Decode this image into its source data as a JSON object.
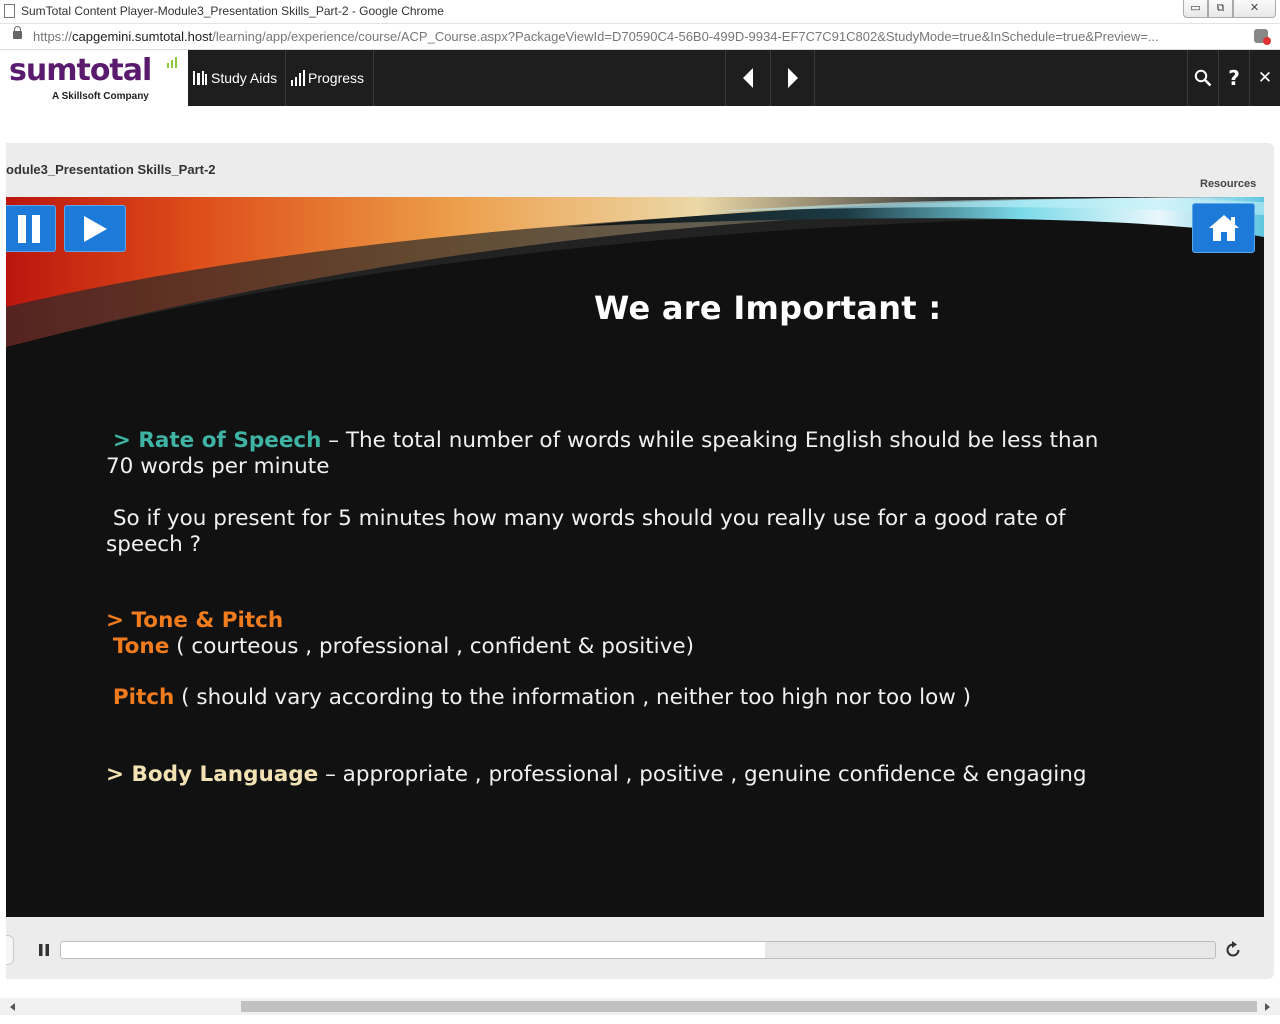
{
  "window": {
    "title": "SumTotal Content Player-Module3_Presentation Skills_Part-2 - Google Chrome",
    "controls": {
      "minimize": "▭",
      "maximize": "⧉",
      "close": "✕"
    }
  },
  "address_bar": {
    "scheme": "https://",
    "host": "capgemini.sumtotal.host",
    "path": "/learning/app/experience/course/ACP_Course.aspx?PackageViewId=D70590C4-56B0-499D-9934-EF7C7C91C802&StudyMode=true&InSchedule=true&Preview=..."
  },
  "app_nav": {
    "logo": {
      "brand": "sumtotal",
      "tagline": "A Skillsoft Company"
    },
    "study_aids_label": "Study Aids",
    "progress_label": "Progress",
    "icons": [
      "study-aids-icon",
      "progress-icon",
      "previous-arrow-icon",
      "next-arrow-icon",
      "search-icon",
      "help-icon",
      "close-icon"
    ],
    "help_glyph": "?",
    "close_glyph": "✕"
  },
  "player": {
    "course_title": "odule3_Presentation Skills_Part-2",
    "resources_label": "Resources",
    "progress_fraction": 0.61
  },
  "slide": {
    "title": "We are Important  :",
    "rate": {
      "bullet": "> Rate of Speech",
      "text": " – The total number of words while speaking English should be less than 70 words per minute"
    },
    "rate_question": "So if you present for 5 minutes how many words should you really use for a good rate of speech ?",
    "tone_pitch_heading": "> Tone & Pitch",
    "tone": {
      "label": "Tone",
      "text": "  ( courteous , professional , confident & positive)"
    },
    "pitch": {
      "label": "Pitch",
      "text": " ( should vary according to the information , neither too high nor too low )"
    },
    "body": {
      "bullet": "> Body Language",
      "text": " – appropriate , professional , positive , genuine confidence & engaging"
    }
  },
  "colors": {
    "nav_bg": "#1e1e1e",
    "brand_purple": "#5a1a6e",
    "button_blue": "#1d7ad8",
    "teal": "#3fb3a4",
    "orange": "#f07c1e",
    "cream": "#f3e2b3"
  }
}
